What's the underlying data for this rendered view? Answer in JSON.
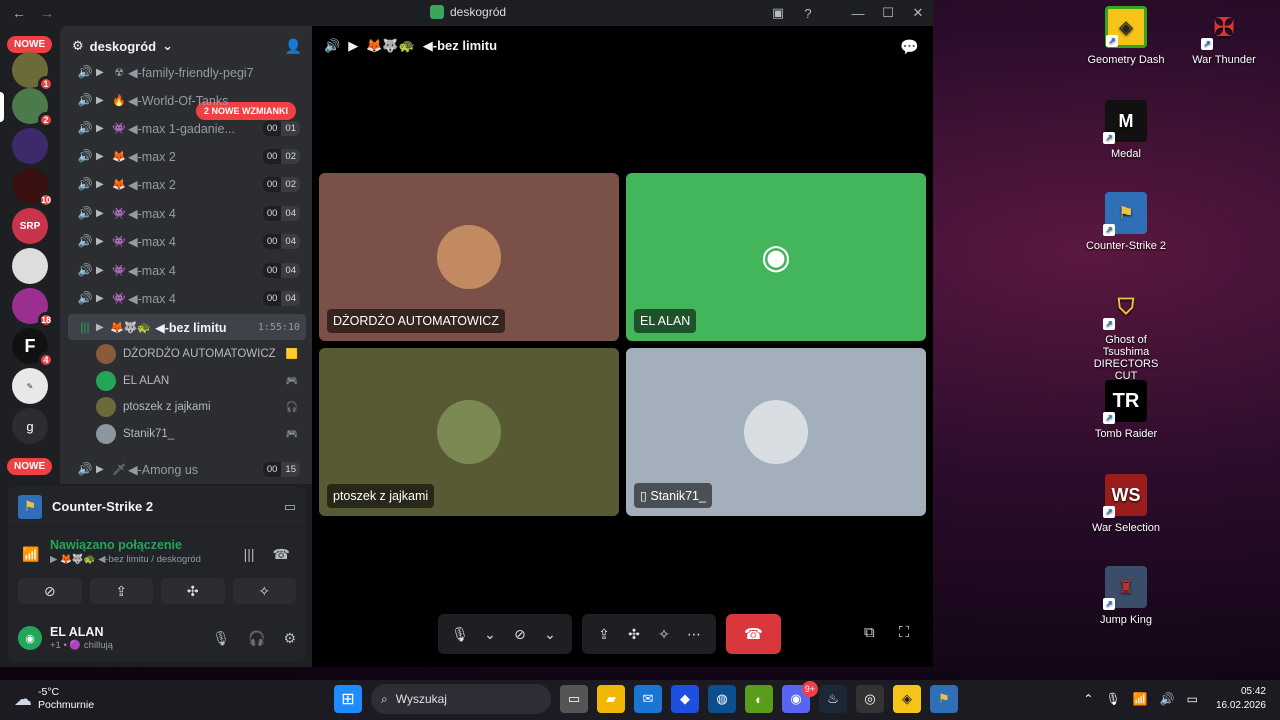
{
  "window": {
    "title": "deskogród",
    "help": "?"
  },
  "guilds": {
    "nowe_top": "NOWE",
    "nowe_bottom": "NOWE",
    "badges": [
      "1",
      "2",
      "10",
      "18",
      "4"
    ],
    "g_label": "g",
    "f_label": "F"
  },
  "server": {
    "name": "deskogród"
  },
  "mention_pill": "2 NOWE WZMIANKI",
  "channels": [
    {
      "emoji": "☢",
      "name": "◀-family-friendly-pegi7",
      "u": "",
      "m": ""
    },
    {
      "emoji": "🔥",
      "name": "◀-World-Of-Tanks",
      "u": "",
      "m": ""
    },
    {
      "emoji": "👾",
      "name": "◀-max 1-gadanie...",
      "u": "00",
      "m": "01"
    },
    {
      "emoji": "🦊",
      "name": "◀-max 2",
      "u": "00",
      "m": "02"
    },
    {
      "emoji": "🦊",
      "name": "◀-max 2",
      "u": "00",
      "m": "02"
    },
    {
      "emoji": "👾",
      "name": "◀-max 4",
      "u": "00",
      "m": "04"
    },
    {
      "emoji": "👾",
      "name": "◀-max 4",
      "u": "00",
      "m": "04"
    },
    {
      "emoji": "👾",
      "name": "◀-max 4",
      "u": "00",
      "m": "04"
    },
    {
      "emoji": "👾",
      "name": "◀-max 4",
      "u": "00",
      "m": "04"
    }
  ],
  "active_channel": {
    "emoji": "🦊🐺🐢",
    "name": "◀-bez limitu",
    "timer": "1:55:10"
  },
  "members": [
    {
      "name": "DŻORDŻO AUTOMATOWICZ",
      "tag": "🟨"
    },
    {
      "name": "EL ALAN",
      "tag": "🎮"
    },
    {
      "name": "ptoszek z jajkami",
      "tag": "🎧"
    },
    {
      "name": "Stanik71_",
      "tag": "🎮"
    }
  ],
  "last_channel": {
    "emoji": "🗡",
    "name": "◀-Among us",
    "u": "00",
    "m": "15"
  },
  "panel": {
    "game": "Counter-Strike 2",
    "status": "Nawiązano połączenie",
    "location": "▶ 🦊🐺🐢 ◀-bez limitu / deskogród",
    "user": "EL ALAN",
    "user_status": "+1 • 🟣 chillują"
  },
  "call": {
    "header": "◀-bez limitu",
    "header_emoji": "🦊🐺🐢",
    "tiles": [
      {
        "label": "DŻORDŻO AUTOMATOWICZ",
        "color": "#7a5048"
      },
      {
        "label": "EL ALAN",
        "color": "#43b55a"
      },
      {
        "label": "ptoszek z jajkami",
        "color": "#585a34"
      },
      {
        "label": "Stanik71_",
        "color": "#a3b0bb"
      }
    ]
  },
  "desktop_icons": [
    {
      "label": "Geometry Dash"
    },
    {
      "label": "War Thunder"
    },
    {
      "label": "Medal"
    },
    {
      "label": "Counter-Strike 2"
    },
    {
      "label": "Ghost of Tsushima DIRECTORS CUT"
    },
    {
      "label": "Tomb Raider"
    },
    {
      "label": "War Selection"
    },
    {
      "label": "Jump King"
    }
  ],
  "taskbar": {
    "temp": "-5°C",
    "weather": "Pochmurnie",
    "search_placeholder": "Wyszukaj",
    "time": "05:42",
    "date": "16.02.2026",
    "discord_badge": "9+"
  }
}
